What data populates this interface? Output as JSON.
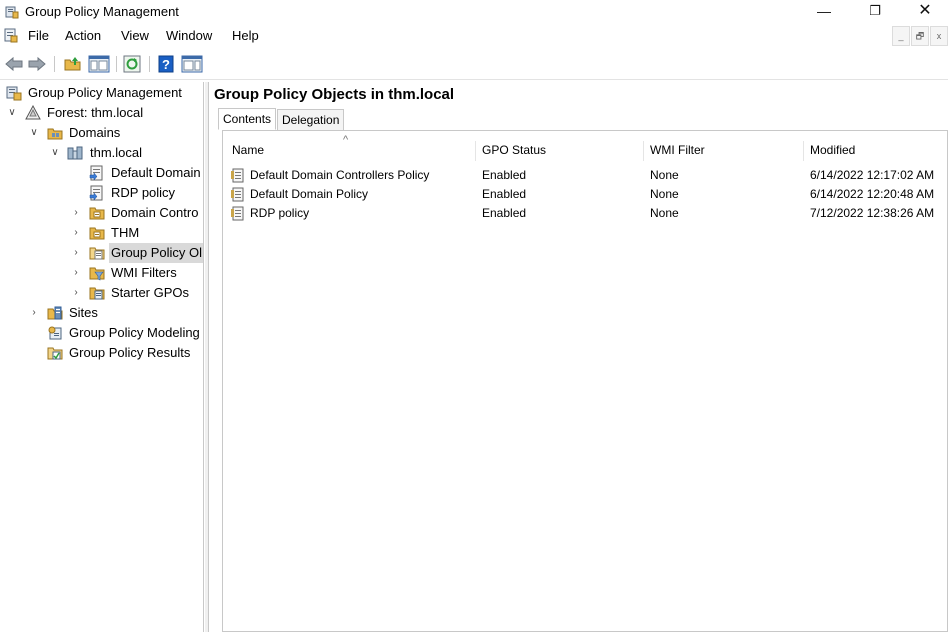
{
  "window": {
    "title": "Group Policy Management",
    "controls": {
      "minimize": "—",
      "maximize": "❐",
      "close": "✕"
    }
  },
  "menubar": {
    "items": [
      "File",
      "Action",
      "View",
      "Window",
      "Help"
    ],
    "mdi_controls": [
      "_",
      "🗗",
      "x"
    ]
  },
  "toolbar": {
    "buttons": [
      "back-icon",
      "forward-icon",
      "up-folder-icon",
      "show-hide-tree-icon",
      "refresh-icon",
      "help-icon",
      "action-pane-icon"
    ]
  },
  "tree": {
    "items": [
      {
        "label": "Group Policy Management",
        "icon": "gpm-console-icon",
        "expander": "",
        "level": 0
      },
      {
        "label": "Forest: thm.local",
        "icon": "forest-icon",
        "expander": "v",
        "level": 0
      },
      {
        "label": "Domains",
        "icon": "domains-icon",
        "expander": "v",
        "level": 1
      },
      {
        "label": "thm.local",
        "icon": "domain-icon",
        "expander": "v",
        "level": 2
      },
      {
        "label": "Default Domain",
        "icon": "gpo-link-icon",
        "expander": "",
        "level": 3
      },
      {
        "label": "RDP policy",
        "icon": "gpo-link-icon",
        "expander": "",
        "level": 3
      },
      {
        "label": "Domain Contro",
        "icon": "ou-folder-icon",
        "expander": ">",
        "level": 3
      },
      {
        "label": "THM",
        "icon": "ou-folder-icon",
        "expander": ">",
        "level": 3
      },
      {
        "label": "Group Policy Ol",
        "icon": "gpo-container-icon",
        "expander": ">",
        "level": 3,
        "selected": true
      },
      {
        "label": "WMI Filters",
        "icon": "wmi-filter-icon",
        "expander": ">",
        "level": 3
      },
      {
        "label": "Starter GPOs",
        "icon": "starter-gpo-icon",
        "expander": ">",
        "level": 3
      },
      {
        "label": "Sites",
        "icon": "sites-icon",
        "expander": ">",
        "level": 1
      },
      {
        "label": "Group Policy Modeling",
        "icon": "modeling-icon",
        "expander": "",
        "level": 1
      },
      {
        "label": "Group Policy Results",
        "icon": "results-icon",
        "expander": "",
        "level": 1
      }
    ]
  },
  "main": {
    "title": "Group Policy Objects in thm.local",
    "tabs": [
      "Contents",
      "Delegation"
    ],
    "active_tab": "Contents",
    "columns": [
      "Name",
      "GPO Status",
      "WMI Filter",
      "Modified"
    ],
    "sort_indicator": "^",
    "rows": [
      {
        "name": "Default Domain Controllers Policy",
        "status": "Enabled",
        "wmi": "None",
        "modified": "6/14/2022 12:17:02 AM"
      },
      {
        "name": "Default Domain Policy",
        "status": "Enabled",
        "wmi": "None",
        "modified": "6/14/2022 12:20:48 AM"
      },
      {
        "name": "RDP policy",
        "status": "Enabled",
        "wmi": "None",
        "modified": "7/12/2022 12:38:26 AM"
      }
    ]
  },
  "colors": {
    "selection": "#d9d9d9",
    "border": "#c8c8c8",
    "folder": "#e8b84a",
    "help_blue": "#1a5fc4",
    "refresh_green": "#2e9e3e"
  }
}
